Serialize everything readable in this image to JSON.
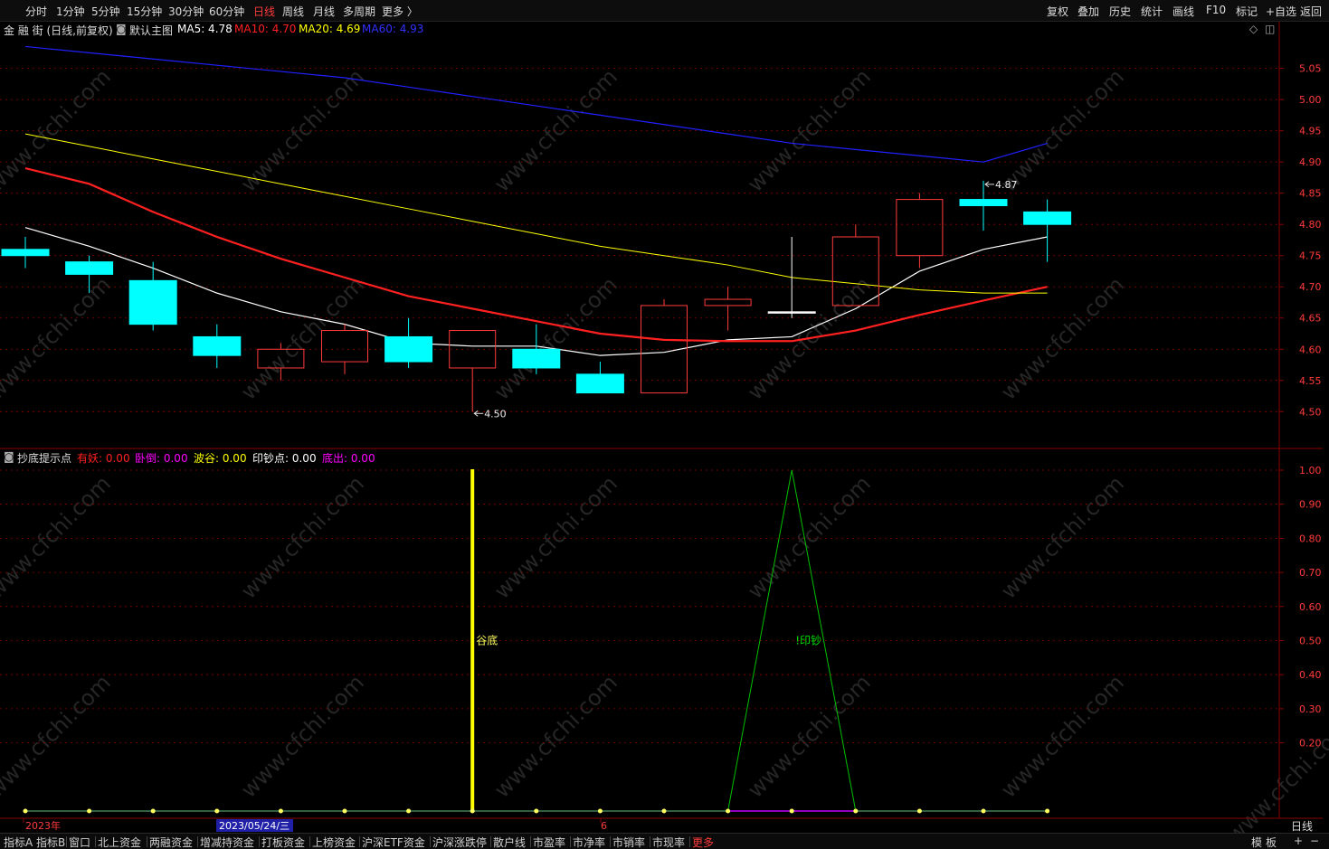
{
  "toolbar": {
    "periods": [
      "分时",
      "1分钟",
      "5分钟",
      "15分钟",
      "30分钟",
      "60分钟",
      "日线",
      "周线",
      "月线",
      "多周期",
      "更多 〉"
    ],
    "active_period": "日线",
    "tools": [
      "复权",
      "叠加",
      "历史",
      "统计",
      "画线",
      "F10",
      "标记",
      "+自选",
      "返回"
    ]
  },
  "main_legend": {
    "stock": "金 融 街 (日线,前复权)",
    "template": "默认主图",
    "ma5": "MA5: 4.78",
    "ma10": "MA10: 4.70",
    "ma20": "MA20: 4.69",
    "ma60": "MA60: 4.93"
  },
  "sub_legend": {
    "name": "抄底提示点",
    "youyao": "有妖: 0.00",
    "daoxia": "卧倒: 0.00",
    "bogu": "波谷: 0.00",
    "yinchao": "印钞点: 0.00",
    "dichu": "底出: 0.00"
  },
  "colors": {
    "up": "#ff3b3b",
    "down": "#00ffff",
    "ma5": "#ffffff",
    "ma10": "#ff2020",
    "ma20": "#ffff00",
    "ma60": "#2020ff",
    "grid": "#8a0000",
    "signal_line": "#00c000",
    "valley_bar": "#ffff00",
    "dot": "#ffff60",
    "baseline": "#c000ff"
  },
  "chart_data": [
    {
      "type": "candlestick",
      "ylim": [
        4.47,
        5.09
      ],
      "y_ticks": [
        "5.05",
        "5.00",
        "4.95",
        "4.90",
        "4.85",
        "4.80",
        "4.75",
        "4.70",
        "4.65",
        "4.60",
        "4.55",
        "4.50"
      ],
      "candles": [
        {
          "o": 4.76,
          "c": 4.75,
          "h": 4.78,
          "l": 4.73
        },
        {
          "o": 4.74,
          "c": 4.72,
          "h": 4.75,
          "l": 4.69
        },
        {
          "o": 4.71,
          "c": 4.64,
          "h": 4.74,
          "l": 4.63
        },
        {
          "o": 4.62,
          "c": 4.59,
          "h": 4.64,
          "l": 4.57
        },
        {
          "o": 4.57,
          "c": 4.6,
          "h": 4.61,
          "l": 4.55
        },
        {
          "o": 4.58,
          "c": 4.63,
          "h": 4.64,
          "l": 4.56
        },
        {
          "o": 4.62,
          "c": 4.58,
          "h": 4.65,
          "l": 4.57
        },
        {
          "o": 4.57,
          "c": 4.63,
          "h": 4.63,
          "l": 4.5
        },
        {
          "o": 4.6,
          "c": 4.57,
          "h": 4.64,
          "l": 4.56
        },
        {
          "o": 4.56,
          "c": 4.53,
          "h": 4.58,
          "l": 4.53
        },
        {
          "o": 4.53,
          "c": 4.67,
          "h": 4.68,
          "l": 4.53
        },
        {
          "o": 4.67,
          "c": 4.68,
          "h": 4.7,
          "l": 4.63
        },
        {
          "o": 4.66,
          "c": 4.66,
          "h": 4.78,
          "l": 4.65
        },
        {
          "o": 4.67,
          "c": 4.78,
          "h": 4.8,
          "l": 4.67
        },
        {
          "o": 4.75,
          "c": 4.84,
          "h": 4.85,
          "l": 4.73
        },
        {
          "o": 4.84,
          "c": 4.83,
          "h": 4.87,
          "l": 4.79
        },
        {
          "o": 4.82,
          "c": 4.8,
          "h": 4.84,
          "l": 4.74
        }
      ],
      "series": [
        {
          "name": "MA5",
          "values": [
            4.795,
            4.765,
            4.73,
            4.69,
            4.66,
            4.64,
            4.61,
            4.605,
            4.605,
            4.59,
            4.595,
            4.615,
            4.62,
            4.665,
            4.725,
            4.76,
            4.78
          ]
        },
        {
          "name": "MA10",
          "values": [
            4.89,
            4.865,
            4.82,
            4.78,
            4.745,
            4.715,
            4.685,
            4.665,
            4.645,
            4.625,
            4.615,
            4.613,
            4.613,
            4.63,
            4.655,
            4.678,
            4.7
          ]
        },
        {
          "name": "MA20",
          "values": [
            4.945,
            4.925,
            4.905,
            4.885,
            4.865,
            4.845,
            4.825,
            4.805,
            4.785,
            4.765,
            4.75,
            4.735,
            4.715,
            4.705,
            4.695,
            4.69,
            4.69
          ]
        },
        {
          "name": "MA60",
          "values": [
            5.085,
            5.075,
            5.065,
            5.055,
            5.045,
            5.035,
            5.02,
            5.005,
            4.99,
            4.975,
            4.96,
            4.945,
            4.93,
            4.92,
            4.91,
            4.9,
            4.93
          ]
        }
      ],
      "annotations": [
        {
          "text": "4.50",
          "candle": 7,
          "value": 4.5
        },
        {
          "text": "4.87",
          "candle": 15,
          "value": 4.87
        }
      ]
    },
    {
      "type": "line",
      "title": "抄底提示点",
      "ylim": [
        0,
        1.0
      ],
      "y_ticks": [
        "1.00",
        "0.90",
        "0.80",
        "0.70",
        "0.60",
        "0.50",
        "0.40",
        "0.30",
        "0.20"
      ],
      "series": [
        {
          "name": "印钞点",
          "values": [
            0,
            0,
            0,
            0,
            0,
            0,
            0,
            0,
            0,
            0,
            0,
            0,
            1,
            0,
            0,
            0,
            0
          ]
        }
      ],
      "valley_bar_index": 7,
      "labels": [
        {
          "text": "谷底",
          "candle": 7,
          "value": 0.5
        },
        {
          "text": "!印钞",
          "candle": 12,
          "value": 0.5
        }
      ]
    }
  ],
  "x_axis": {
    "year": "2023年",
    "crosshair_date": "2023/05/24/三",
    "month": "6",
    "period": "日线"
  },
  "bottom_tabs": [
    "指标A",
    "指标B",
    "窗口",
    "北上资金",
    "两融资金",
    "增减持资金",
    "打板资金",
    "上榜资金",
    "沪深ETF资金",
    "沪深涨跌停",
    "散户线",
    "市盈率",
    "市净率",
    "市销率",
    "市现率",
    "更多"
  ],
  "bottom_right": [
    "模",
    "板",
    "+",
    "−"
  ],
  "watermark": "www.cfchi.com"
}
